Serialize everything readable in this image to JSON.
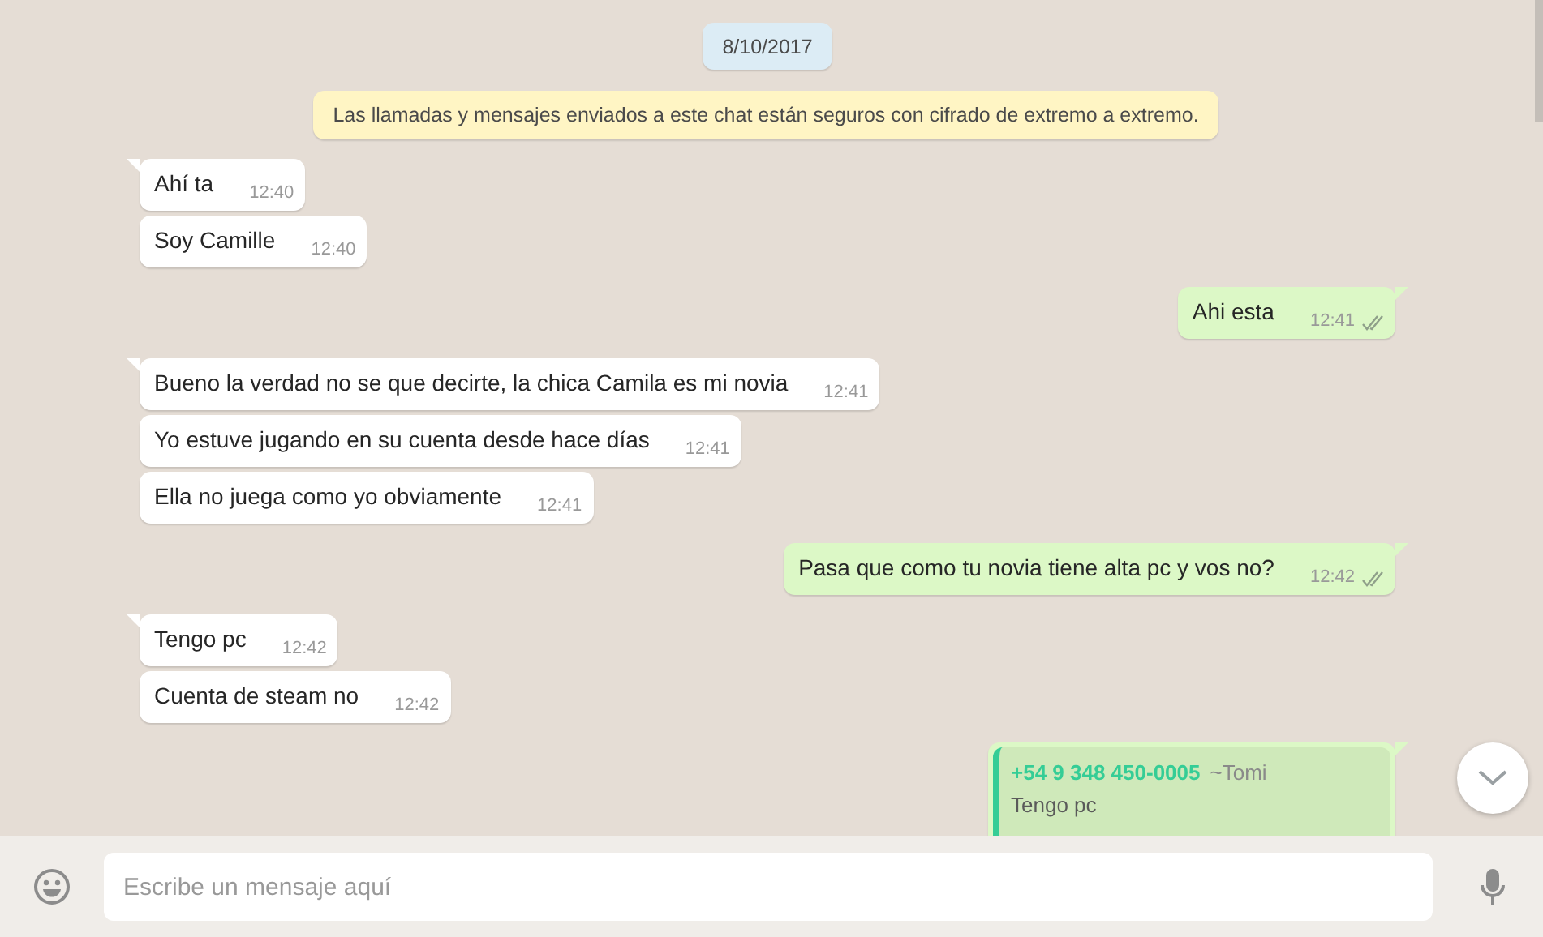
{
  "date_chip": "8/10/2017",
  "encryption_notice": "Las llamadas y mensajes enviados a este chat están seguros con cifrado de extremo a extremo.",
  "messages": [
    {
      "kind": "incoming",
      "first": true,
      "text": "Ahí ta",
      "time": "12:40"
    },
    {
      "kind": "incoming",
      "first": false,
      "text": "Soy Camille",
      "time": "12:40"
    },
    {
      "kind": "outgoing",
      "first": true,
      "text": "Ahi esta",
      "time": "12:41"
    },
    {
      "kind": "incoming",
      "first": true,
      "text": "Bueno la verdad no se que decirte, la chica Camila es mi novia",
      "time": "12:41"
    },
    {
      "kind": "incoming",
      "first": false,
      "text": "Yo estuve jugando en su cuenta desde hace días",
      "time": "12:41"
    },
    {
      "kind": "incoming",
      "first": false,
      "text": "Ella no juega como yo obviamente",
      "time": "12:41"
    },
    {
      "kind": "outgoing",
      "first": true,
      "text": "Pasa que como tu novia tiene alta pc y vos no?",
      "time": "12:42"
    },
    {
      "kind": "incoming",
      "first": true,
      "text": "Tengo pc",
      "time": "12:42"
    },
    {
      "kind": "incoming",
      "first": false,
      "text": "Cuenta de steam no",
      "time": "12:42"
    },
    {
      "kind": "outgoing",
      "first": true,
      "quote": {
        "author": "+54 9 348 450-0005",
        "name": "~Tomi",
        "text": "Tengo pc"
      }
    }
  ],
  "composer": {
    "placeholder": "Escribe un mensaje aquí"
  }
}
